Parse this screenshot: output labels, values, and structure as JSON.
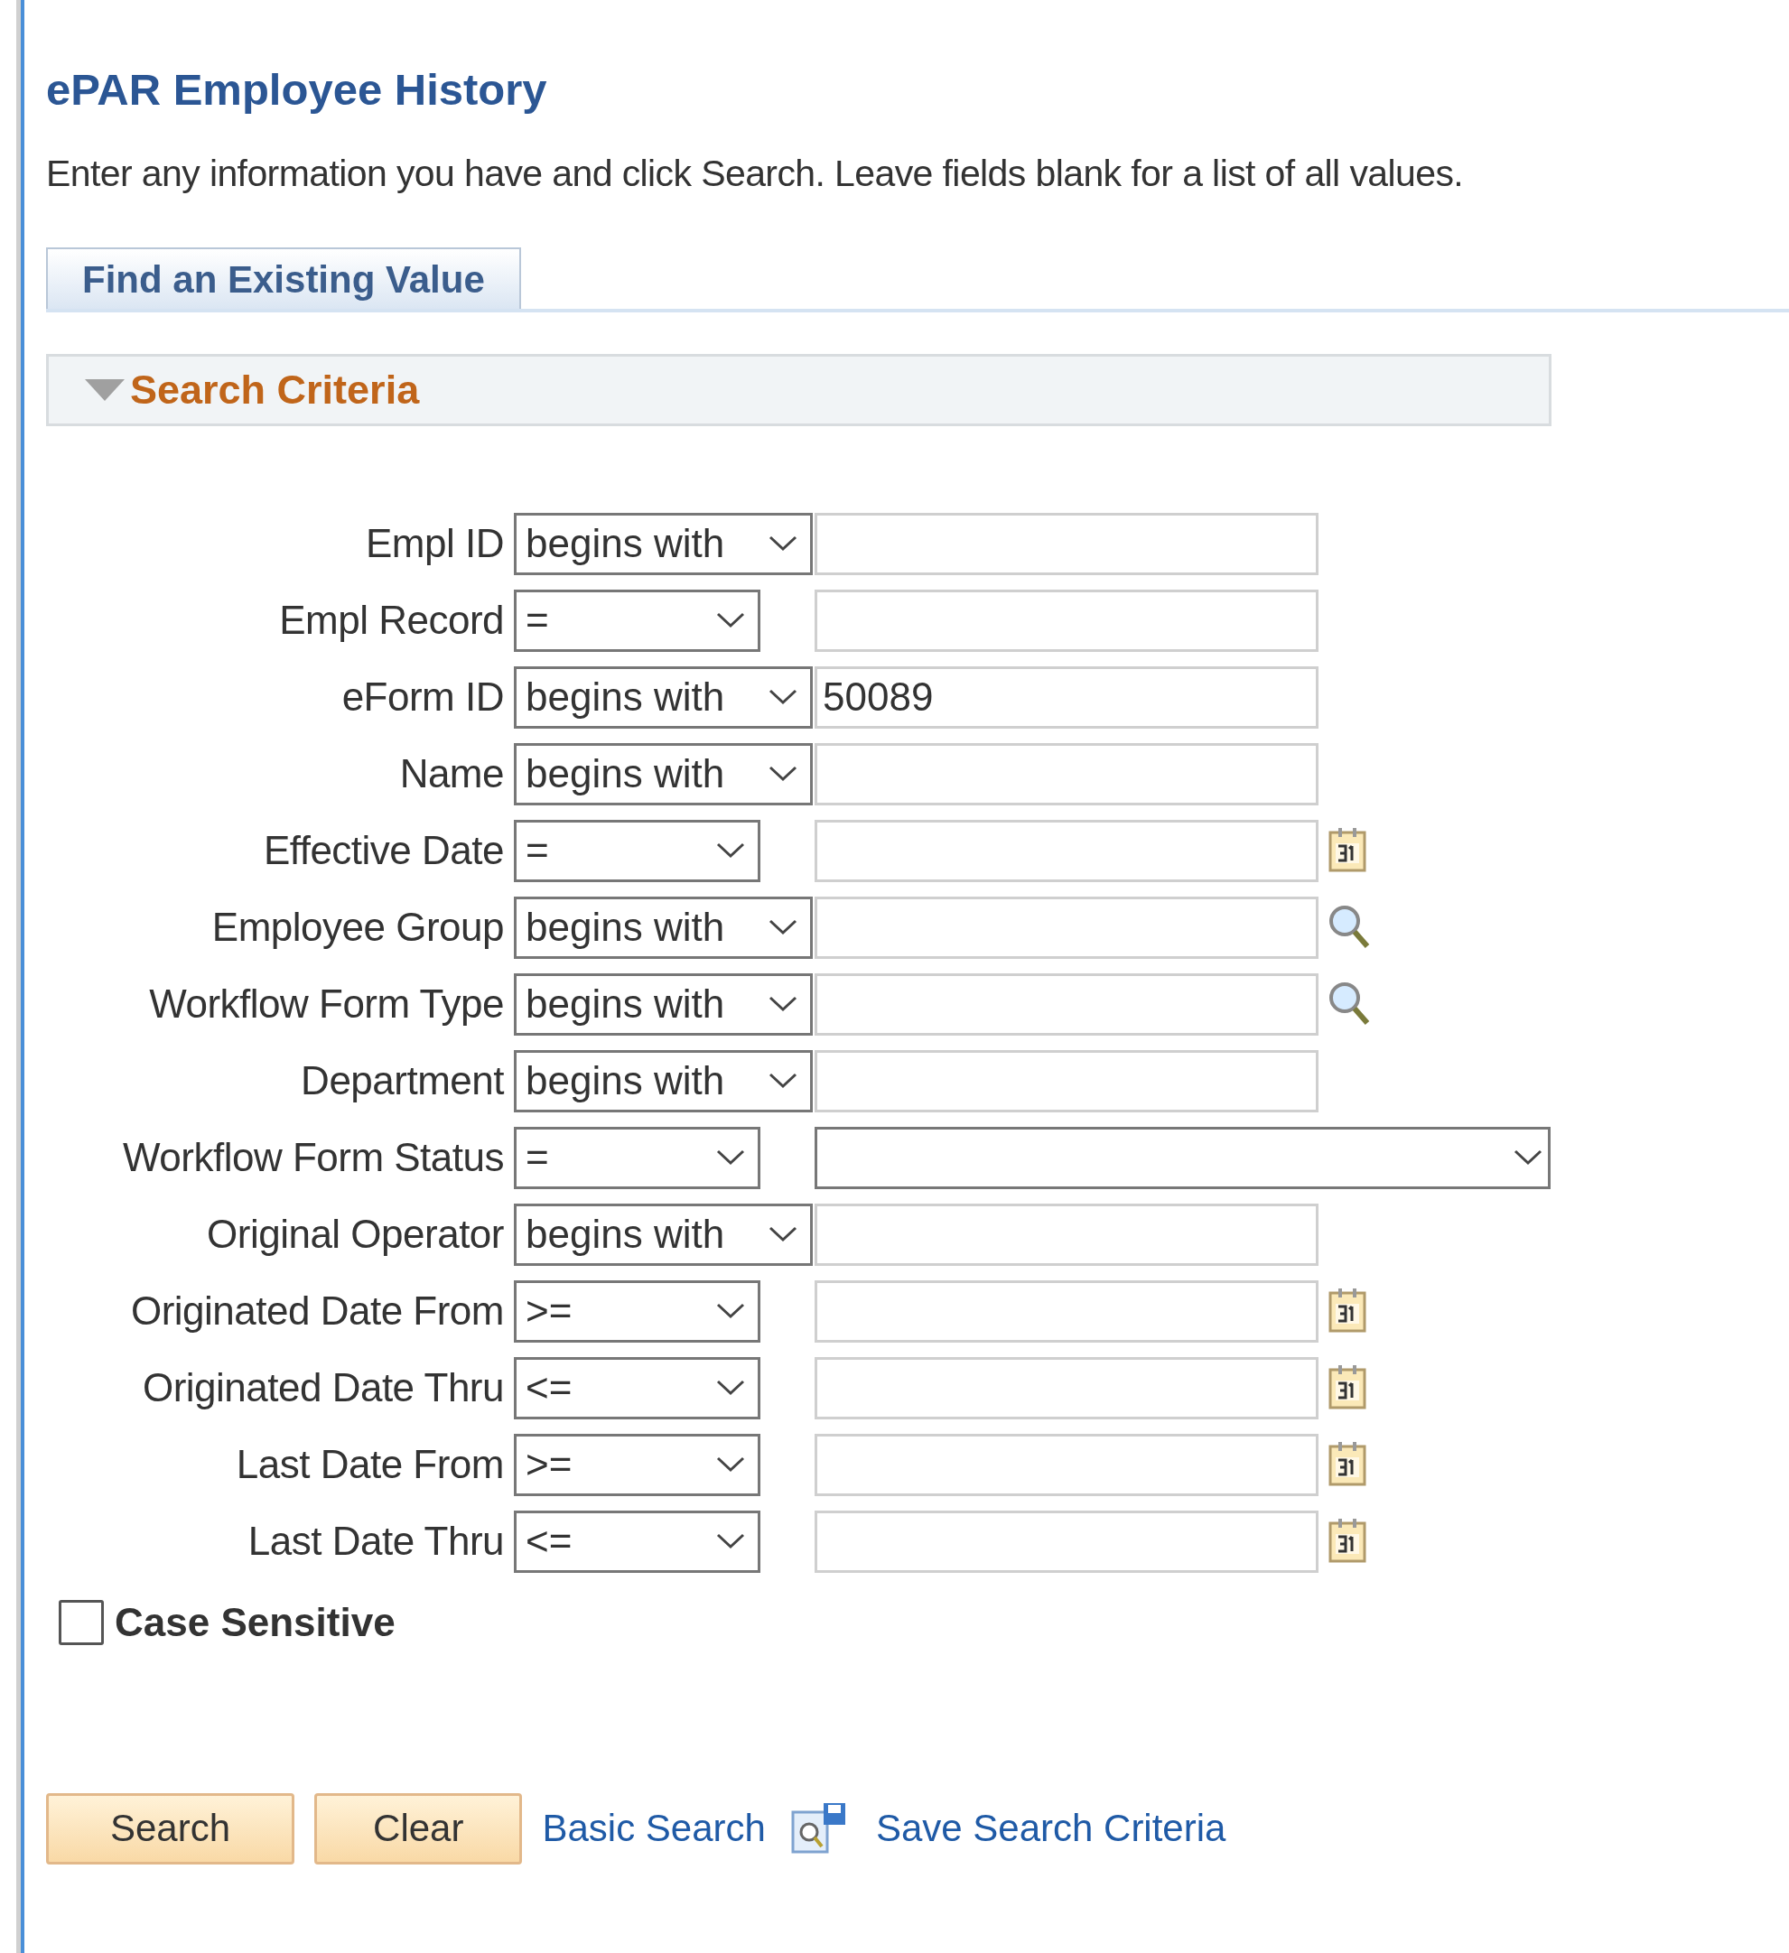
{
  "title": "ePAR Employee History",
  "instructions": "Enter any information you have and click Search. Leave fields blank for a list of all values.",
  "tabs": [
    {
      "label": "Find an Existing Value",
      "selected": true
    }
  ],
  "section": {
    "title": "Search Criteria",
    "expanded": true
  },
  "fields": [
    {
      "label": "Empl ID",
      "operator": "begins with",
      "kind": "text"
    },
    {
      "label": "Empl Record",
      "operator": "=",
      "kind": "text"
    },
    {
      "label": "eForm ID",
      "operator": "begins with",
      "kind": "text",
      "value": "50089"
    },
    {
      "label": "Name",
      "operator": "begins with",
      "kind": "text"
    },
    {
      "label": "Effective Date",
      "operator": "=",
      "kind": "date"
    },
    {
      "label": "Employee Group",
      "operator": "begins with",
      "kind": "lookup"
    },
    {
      "label": "Workflow Form Type",
      "operator": "begins with",
      "kind": "lookup"
    },
    {
      "label": "Department",
      "operator": "begins with",
      "kind": "text"
    },
    {
      "label": "Workflow Form Status",
      "operator": "=",
      "kind": "select"
    },
    {
      "label": "Original Operator",
      "operator": "begins with",
      "kind": "text"
    },
    {
      "label": "Originated Date From",
      "operator": ">=",
      "kind": "date"
    },
    {
      "label": "Originated Date Thru",
      "operator": "<=",
      "kind": "date"
    },
    {
      "label": "Last Date From",
      "operator": ">=",
      "kind": "date"
    },
    {
      "label": "Last Date Thru",
      "operator": "<=",
      "kind": "date"
    }
  ],
  "case_sensitive": {
    "label": "Case Sensitive",
    "checked": false
  },
  "actions": [
    {
      "kind": "button",
      "label": "Search"
    },
    {
      "kind": "button",
      "label": "Clear"
    },
    {
      "kind": "link",
      "label": "Basic Search"
    },
    {
      "kind": "icon-link",
      "label": "Save Search Criteria"
    }
  ]
}
